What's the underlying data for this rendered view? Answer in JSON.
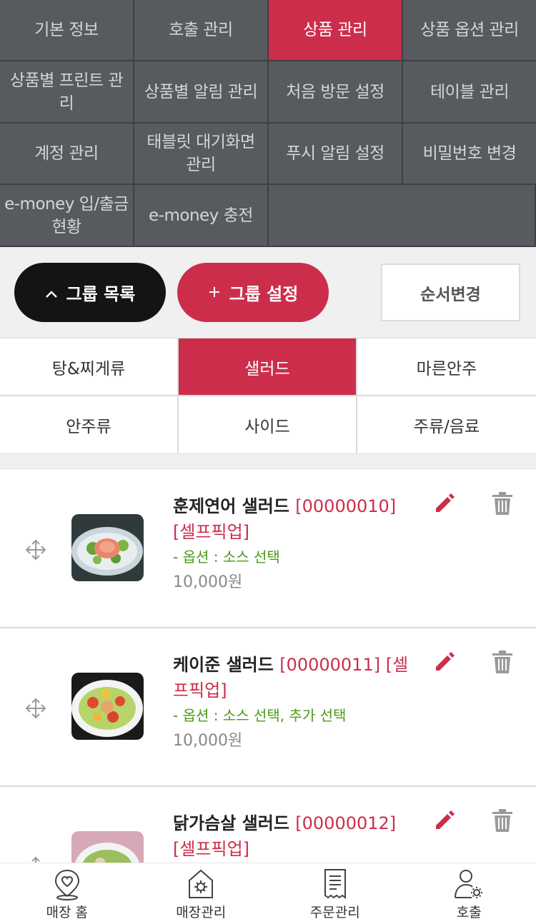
{
  "menu": [
    {
      "label": "기본 정보",
      "active": false
    },
    {
      "label": "호출 관리",
      "active": false
    },
    {
      "label": "상품 관리",
      "active": true
    },
    {
      "label": "상품 옵션 관리",
      "active": false
    },
    {
      "label": "상품별 프린트 관리",
      "active": false
    },
    {
      "label": "상품별 알림 관리",
      "active": false
    },
    {
      "label": "처음 방문 설정",
      "active": false
    },
    {
      "label": "테이블 관리",
      "active": false
    },
    {
      "label": "계정 관리",
      "active": false
    },
    {
      "label": "태블릿 대기화면 관리",
      "active": false
    },
    {
      "label": "푸시 알림 설정",
      "active": false
    },
    {
      "label": "비밀번호 변경",
      "active": false
    },
    {
      "label": "e-money 입/출금 현황",
      "active": false
    },
    {
      "label": "e-money 충전",
      "active": false
    }
  ],
  "actions": {
    "group_list": "그룹 목록",
    "group_list_icon": "^",
    "group_set": "그룹 설정",
    "group_set_icon": "+",
    "order_change": "순서변경"
  },
  "categories": [
    {
      "label": "탕&찌게류",
      "active": false
    },
    {
      "label": "샐러드",
      "active": true
    },
    {
      "label": "마른안주",
      "active": false
    },
    {
      "label": "안주류",
      "active": false
    },
    {
      "label": "사이드",
      "active": false
    },
    {
      "label": "주류/음료",
      "active": false
    }
  ],
  "products": [
    {
      "name": "훈제연어 샐러드",
      "code": "[00000010] [셀프픽업]",
      "option": "- 옵션 : 소스 선택",
      "price": "10,000원",
      "thumb": "salmon-salad"
    },
    {
      "name": "케이준 샐러드",
      "code": "[00000011] [셀프픽업]",
      "option": "- 옵션 : 소스 선택, 추가 선택",
      "price": "10,000원",
      "thumb": "cajun-salad"
    },
    {
      "name": "닭가슴살 샐러드",
      "code": "[00000012] [셀프픽업]",
      "option": "",
      "price": "",
      "thumb": "chicken-salad"
    }
  ],
  "bottom_nav": [
    {
      "label": "매장 홈",
      "icon": "store-home-icon"
    },
    {
      "label": "매장관리",
      "icon": "store-settings-icon"
    },
    {
      "label": "주문관리",
      "icon": "order-receipt-icon"
    },
    {
      "label": "호출",
      "icon": "staff-call-icon"
    }
  ],
  "colors": {
    "accent": "#cc2d4b",
    "menu_bg": "#575a5e",
    "option_green": "#4a9a18"
  }
}
